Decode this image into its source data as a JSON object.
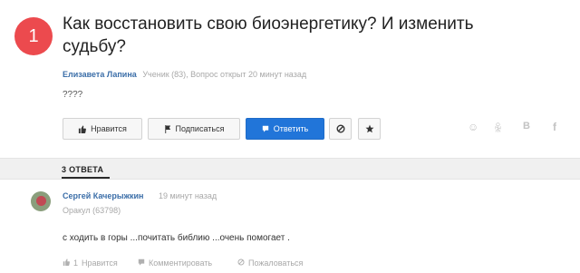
{
  "question": {
    "number": "1",
    "title": "Как восстановить свою биоэнергетику? И изменить судьбу?",
    "author": "Елизавета Лапина",
    "meta": "Ученик (83), Вопрос открыт 20 минут назад",
    "text": "????"
  },
  "actions": {
    "like_label": "Нравится",
    "subscribe_label": "Подписаться",
    "answer_label": "Ответить",
    "report_icon": "ban-icon",
    "favorite_icon": "star-icon"
  },
  "share": {
    "mail": "☺",
    "ok": "ꆜ",
    "vk": "B",
    "fb": "f"
  },
  "answers_tab": {
    "label": "3 ОТВЕТА"
  },
  "answer": {
    "author": "Сергей Качерыжкин",
    "time": "19 минут назад",
    "rank": "Оракул (63798)",
    "text": "с ходить в горы ...почитать библию ...очень помогает .",
    "like_count": "1",
    "like_label": "Нравится",
    "comment_label": "Комментировать",
    "report_label": "Пожаловаться"
  }
}
